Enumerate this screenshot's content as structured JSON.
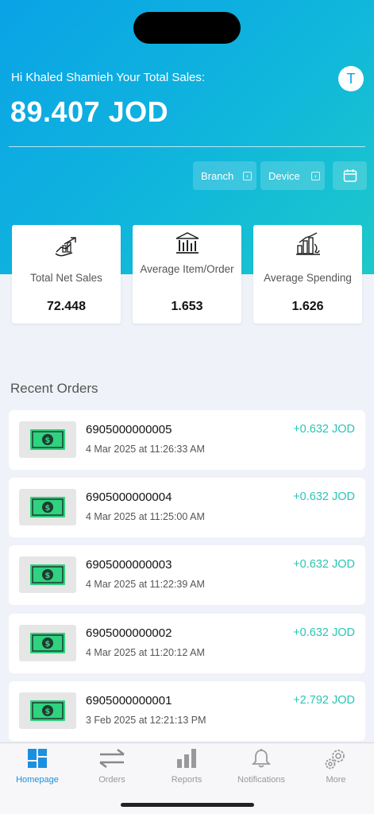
{
  "header": {
    "greeting": "Hi Khaled Shamieh Your Total Sales:",
    "total_sales": "89.407 JOD",
    "avatar_initial": "T"
  },
  "filters": {
    "branch_label": "Branch",
    "device_label": "Device",
    "chevron": "‹"
  },
  "stats": [
    {
      "label": "Total Net Sales",
      "value": "72.448",
      "icon": "hand-chart-icon"
    },
    {
      "label": "Average Item/Order",
      "value": "1.653",
      "icon": "bank-chart-icon"
    },
    {
      "label": "Average Spending",
      "value": "1.626",
      "icon": "growth-bars-icon"
    }
  ],
  "recent_orders": {
    "title": "Recent Orders",
    "items": [
      {
        "id": "6905000000005",
        "date": "4 Mar 2025 at 11:26:33 AM",
        "amount": "+0.632 JOD"
      },
      {
        "id": "6905000000004",
        "date": "4 Mar 2025 at 11:25:00 AM",
        "amount": "+0.632 JOD"
      },
      {
        "id": "6905000000003",
        "date": "4 Mar 2025 at 11:22:39 AM",
        "amount": "+0.632 JOD"
      },
      {
        "id": "6905000000002",
        "date": "4 Mar 2025 at 11:20:12 AM",
        "amount": "+0.632 JOD"
      },
      {
        "id": "6905000000001",
        "date": "3 Feb 2025 at 12:21:13 PM",
        "amount": "+2.792 JOD"
      }
    ]
  },
  "nav": {
    "items": [
      {
        "label": "Homepage",
        "icon": "grid-icon",
        "active": true
      },
      {
        "label": "Orders",
        "icon": "swap-arrows-icon",
        "active": false
      },
      {
        "label": "Reports",
        "icon": "bar-chart-icon",
        "active": false
      },
      {
        "label": "Notifications",
        "icon": "bell-icon",
        "active": false
      },
      {
        "label": "More",
        "icon": "gears-icon",
        "active": false
      }
    ]
  },
  "colors": {
    "accent": "#0aa3e6",
    "positive_amount": "#2bc4b4",
    "nav_active": "#1b8fe0"
  }
}
